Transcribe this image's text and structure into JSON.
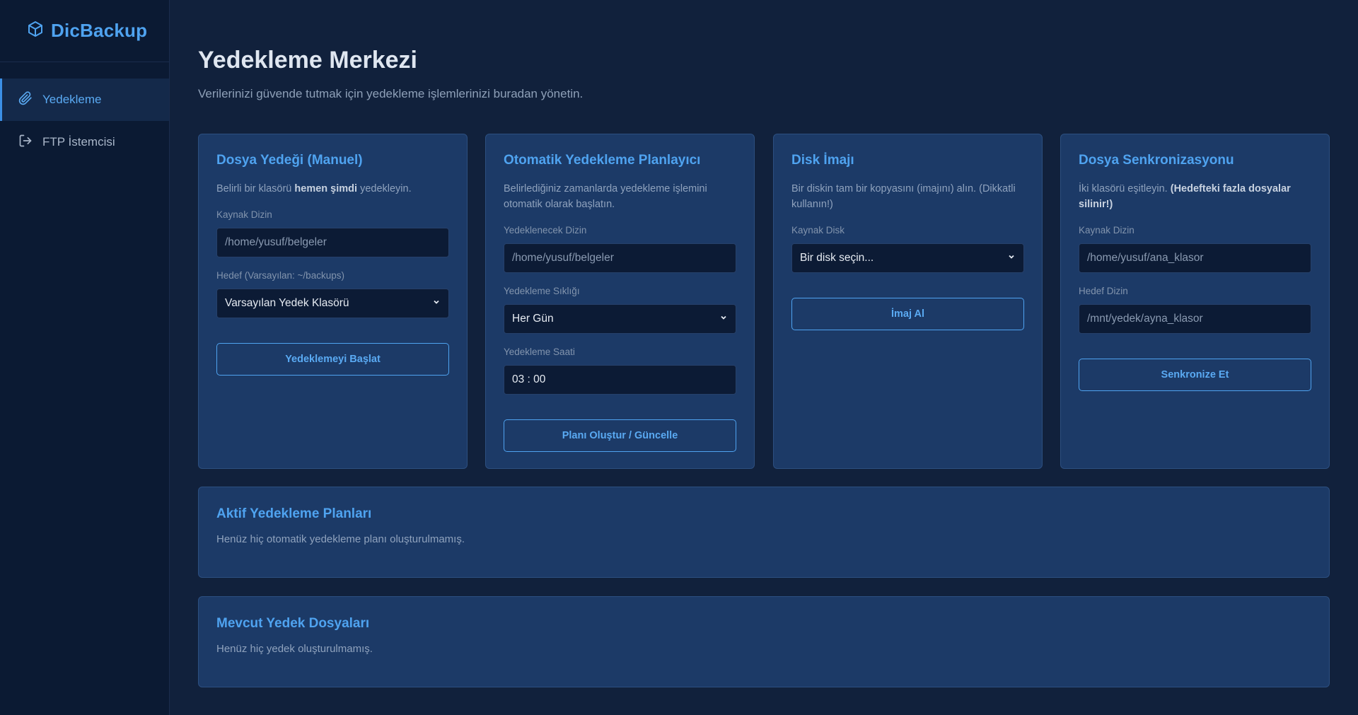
{
  "sidebar": {
    "brand": "DicBackup",
    "items": [
      {
        "label": "Yedekleme",
        "icon": "paperclip-icon",
        "active": true
      },
      {
        "label": "FTP İstemcisi",
        "icon": "sign-out-icon",
        "active": false
      }
    ]
  },
  "header": {
    "title": "Yedekleme Merkezi",
    "subtitle": "Verilerinizi güvende tutmak için yedekleme işlemlerinizi buradan yönetin."
  },
  "cards": {
    "manual": {
      "title": "Dosya Yedeği (Manuel)",
      "desc_pre": "Belirli bir klasörü ",
      "desc_bold": "hemen şimdi",
      "desc_post": " yedekleyin.",
      "source_label": "Kaynak Dizin",
      "source_placeholder": "/home/yusuf/belgeler",
      "target_label": "Hedef (Varsayılan: ~/backups)",
      "target_value": "Varsayılan Yedek Klasörü",
      "button": "Yedeklemeyi Başlat"
    },
    "scheduler": {
      "title": "Otomatik Yedekleme Planlayıcı",
      "desc": "Belirlediğiniz zamanlarda yedekleme işlemini otomatik olarak başlatın.",
      "dir_label": "Yedeklenecek Dizin",
      "dir_placeholder": "/home/yusuf/belgeler",
      "freq_label": "Yedekleme Sıklığı",
      "freq_value": "Her Gün",
      "time_label": "Yedekleme Saati",
      "time_value": "03 : 00",
      "button": "Planı Oluştur / Güncelle"
    },
    "disk": {
      "title": "Disk İmajı",
      "desc": "Bir diskin tam bir kopyasını (imajını) alın. (Dikkatli kullanın!)",
      "source_label": "Kaynak Disk",
      "source_value": "Bir disk seçin...",
      "button": "İmaj Al"
    },
    "sync": {
      "title": "Dosya Senkronizasyonu",
      "desc_pre": "İki klasörü eşitleyin. ",
      "desc_bold": "(Hedefteki fazla dosyalar silinir!)",
      "source_label": "Kaynak Dizin",
      "source_placeholder": "/home/yusuf/ana_klasor",
      "target_label": "Hedef Dizin",
      "target_placeholder": "/mnt/yedek/ayna_klasor",
      "button": "Senkronize Et"
    }
  },
  "plans": {
    "title": "Aktif Yedekleme Planları",
    "empty": "Henüz hiç otomatik yedekleme planı oluşturulmamış."
  },
  "files": {
    "title": "Mevcut Yedek Dosyaları",
    "empty": "Henüz hiç yedek oluşturulmamış."
  },
  "colors": {
    "accent": "#4fa3f0",
    "card_bg": "#1c3a67",
    "page_bg": "#11213c",
    "sidebar_bg": "#0b1a33"
  }
}
